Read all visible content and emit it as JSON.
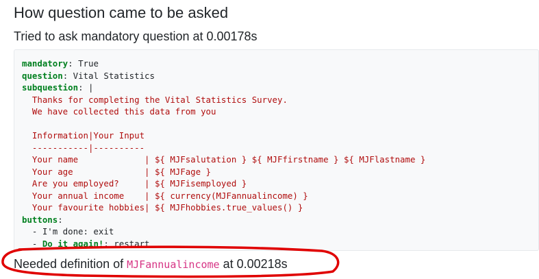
{
  "heading": "How question came to be asked",
  "subheading": "Tried to ask mandatory question at 0.00178s",
  "code": {
    "mandatory_key": "mandatory",
    "mandatory_value": "True",
    "question_key": "question",
    "question_value": "Vital Statistics",
    "subquestion_key": "subquestion",
    "subquestion_value": "|",
    "subquestion_lines": [
      "  Thanks for completing the Vital Statistics Survey.",
      "  We have collected this data from you",
      "",
      "  Information|Your Input",
      "  -----------|----------",
      "  Your name             | ${ MJFsalutation } ${ MJFfirstname } ${ MJFlastname }",
      "  Your age              | ${ MJFage }",
      "  Are you employed?     | ${ MJFisemployed }",
      "  Your annual income    | ${ currency(MJFannualincome) }",
      "  Your favourite hobbies| ${ MJFhobbies.true_values() }"
    ],
    "buttons_key": "buttons",
    "button_1_text": "  - I'm done: exit",
    "button_2_dash": "  - ",
    "button_2_key": "Do it again!",
    "button_2_value": ": restart"
  },
  "footer": {
    "prefix": "Needed definition of ",
    "variable": "MJFannualincome",
    "suffix": " at 0.00218s"
  },
  "colors": {
    "key_green": "#00801f",
    "string_red": "#b00d0d",
    "code_var_pink": "#d63384",
    "annotation_red": "#e00000"
  }
}
